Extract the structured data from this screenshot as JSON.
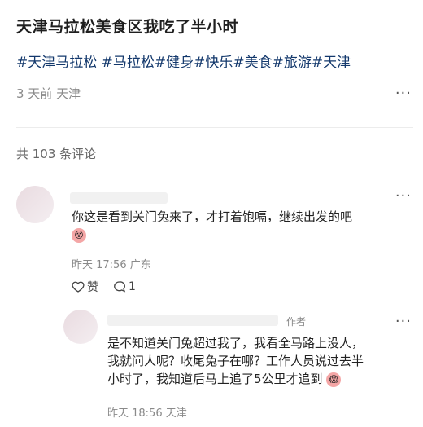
{
  "post": {
    "title": "天津马拉松美食区我吃了半小时",
    "tags": "#天津马拉松 #马拉松#健身#快乐#美食#旅游#天津",
    "meta": "3 天前 天津",
    "more": "···"
  },
  "comments_header": {
    "count_label": "共 103 条评论"
  },
  "comment1": {
    "text": "你这是看到关门兔来了，才打着饱嗝，继续出发的吧",
    "emoji": "😵",
    "time": "昨天 17:56 广东",
    "more": "···",
    "like_label": "赞",
    "reply_count": "1"
  },
  "reply1": {
    "author_badge": "作者",
    "text_lines": [
      "是不知道关门兔超过我了，我看全马路上没人，",
      "我就问人呢？收尾兔子在哪？工作人员说过去半",
      "小时了，我知道后马上追了5公里才追到"
    ],
    "emoji": "😱",
    "time": "昨天 18:56 天津",
    "more": "···"
  }
}
